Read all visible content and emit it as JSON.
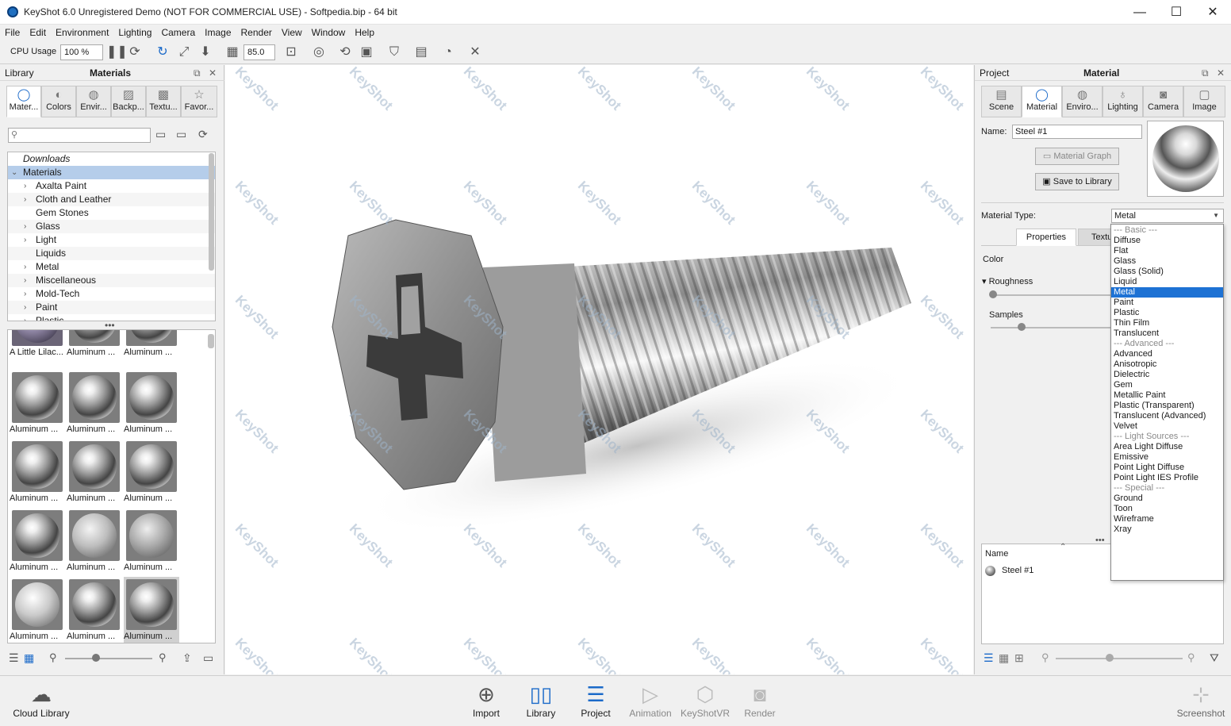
{
  "window": {
    "title": "KeyShot 6.0 Unregistered Demo (NOT FOR COMMERCIAL USE) - Softpedia.bip  - 64 bit",
    "minimize": "—",
    "maximize": "☐",
    "close": "✕"
  },
  "menu": [
    "File",
    "Edit",
    "Environment",
    "Lighting",
    "Camera",
    "Image",
    "Render",
    "View",
    "Window",
    "Help"
  ],
  "toolbar": {
    "cpu_label": "CPU Usage",
    "cpu_value": "100 %",
    "fov_value": "85.0"
  },
  "library": {
    "header_left": "Library",
    "header_title": "Materials",
    "tabs": [
      "Mater...",
      "Colors",
      "Envir...",
      "Backp...",
      "Textu...",
      "Favor..."
    ],
    "search_placeholder": "",
    "tree": [
      "Downloads",
      "Materials",
      "Axalta Paint",
      "Cloth and Leather",
      "Gem Stones",
      "Glass",
      "Light",
      "Liquids",
      "Metal",
      "Miscellaneous",
      "Mold-Tech",
      "Paint",
      "Plastic"
    ],
    "thumbs": [
      "A Little Lilac...",
      "Aluminum ...",
      "Aluminum ...",
      "Aluminum ...",
      "Aluminum ...",
      "Aluminum ...",
      "Aluminum ...",
      "Aluminum ...",
      "Aluminum ...",
      "Aluminum ...",
      "Aluminum ...",
      "Aluminum ...",
      "Aluminum ...",
      "Aluminum ...",
      "Aluminum ..."
    ]
  },
  "viewport": {
    "watermark": "KeyShot"
  },
  "project": {
    "header_left": "Project",
    "header_title": "Material",
    "tabs": [
      "Scene",
      "Material",
      "Enviro...",
      "Lighting",
      "Camera",
      "Image"
    ],
    "name_label": "Name:",
    "name_value": "Steel #1",
    "material_graph": "Material Graph",
    "save_to_library": "Save to Library",
    "material_type_label": "Material Type:",
    "material_type_value": "Metal",
    "subtabs": [
      "Properties",
      "Textu"
    ],
    "color_label": "Color",
    "roughness_label": "Roughness",
    "samples_label": "Samples",
    "list_header": "Name",
    "list_item": "Steel #1",
    "dropdown": [
      {
        "t": "--- Basic ---",
        "k": "hdr"
      },
      {
        "t": "Diffuse",
        "k": ""
      },
      {
        "t": "Flat",
        "k": ""
      },
      {
        "t": "Glass",
        "k": ""
      },
      {
        "t": "Glass (Solid)",
        "k": ""
      },
      {
        "t": "Liquid",
        "k": ""
      },
      {
        "t": "Metal",
        "k": "sel"
      },
      {
        "t": "Paint",
        "k": ""
      },
      {
        "t": "Plastic",
        "k": ""
      },
      {
        "t": "Thin Film",
        "k": ""
      },
      {
        "t": "Translucent",
        "k": ""
      },
      {
        "t": "--- Advanced ---",
        "k": "hdr"
      },
      {
        "t": "Advanced",
        "k": ""
      },
      {
        "t": "Anisotropic",
        "k": ""
      },
      {
        "t": "Dielectric",
        "k": ""
      },
      {
        "t": "Gem",
        "k": ""
      },
      {
        "t": "Metallic Paint",
        "k": ""
      },
      {
        "t": "Plastic (Transparent)",
        "k": ""
      },
      {
        "t": "Translucent (Advanced)",
        "k": ""
      },
      {
        "t": "Velvet",
        "k": ""
      },
      {
        "t": "--- Light Sources ---",
        "k": "hdr"
      },
      {
        "t": "Area Light Diffuse",
        "k": ""
      },
      {
        "t": "Emissive",
        "k": ""
      },
      {
        "t": "Point Light Diffuse",
        "k": ""
      },
      {
        "t": "Point Light IES Profile",
        "k": ""
      },
      {
        "t": "--- Special ---",
        "k": "hdr"
      },
      {
        "t": "Ground",
        "k": ""
      },
      {
        "t": "Toon",
        "k": ""
      },
      {
        "t": "Wireframe",
        "k": ""
      },
      {
        "t": "Xray",
        "k": ""
      }
    ]
  },
  "bottom": {
    "cloud_library": "Cloud Library",
    "buttons": [
      "Import",
      "Library",
      "Project",
      "Animation",
      "KeyShotVR",
      "Render"
    ],
    "screenshot": "Screenshot"
  },
  "colors": {
    "accent": "#1e72d4",
    "selection": "#b5cdea"
  }
}
